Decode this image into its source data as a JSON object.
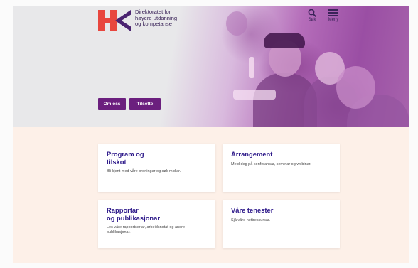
{
  "header": {
    "logo_lines": [
      "Direktoratet for",
      "høyere utdanning",
      "og kompetanse"
    ],
    "search_label": "Søk",
    "menu_label": "Meny"
  },
  "hero": {
    "buttons": [
      {
        "label": "Om oss"
      },
      {
        "label": "Tilsette"
      }
    ]
  },
  "cards": [
    {
      "title_lines": [
        "Program og",
        "tilskot"
      ],
      "description": "Bli kjent med våre ordningar og søk midlar."
    },
    {
      "title_lines": [
        "Arrangement"
      ],
      "description": "Meld deg på konferansar, seminar og webinar."
    },
    {
      "title_lines": [
        "Rapportar",
        "og publikasjonar"
      ],
      "description": "Les våre rapportseriar, arbeidsnotat og andre publikasjonar."
    },
    {
      "title_lines": [
        "Våre tenester"
      ],
      "description": "Sjå våre nettressursar."
    }
  ],
  "colors": {
    "brand_red": "#e8463e",
    "brand_purple": "#4a2370",
    "button_purple": "#6b1f7e",
    "card_title": "#2e1a8a",
    "section_bg": "#fdf0e8"
  },
  "icons": [
    "search-icon",
    "menu-icon"
  ]
}
